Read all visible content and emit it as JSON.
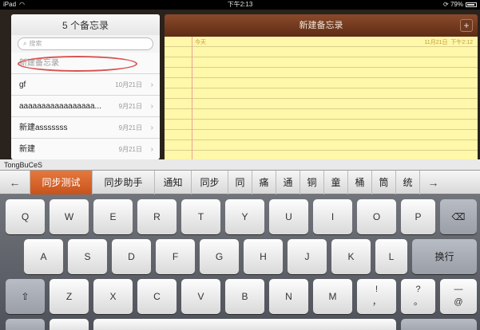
{
  "status_bar": {
    "device": "iPad",
    "time": "下午2:13",
    "battery": "79%"
  },
  "notes_list": {
    "title": "5 个备忘录",
    "search_placeholder": "搜索",
    "items": [
      {
        "title": "新建备忘录",
        "date": ""
      },
      {
        "title": "gf",
        "date": "10月21日"
      },
      {
        "title": "aaaaaaaaaaaaaaaaa...",
        "date": "9月21日"
      },
      {
        "title": "新建asssssss",
        "date": "9月21日"
      },
      {
        "title": "新建",
        "date": "9月21日"
      }
    ]
  },
  "note": {
    "header_title": "新建备忘录",
    "add_label": "+",
    "day_label": "今天",
    "date": "11月21日",
    "time": "下午2:12"
  },
  "keyboard": {
    "pinyin": "TongBuCeS",
    "candidates": [
      "同步测试",
      "同步助手",
      "通知",
      "同步",
      "同",
      "痛",
      "通",
      "铜",
      "童",
      "桶",
      "筒",
      "统"
    ],
    "left_arrow": "←",
    "right_arrow": "→",
    "row1": [
      "Q",
      "W",
      "E",
      "R",
      "T",
      "Y",
      "U",
      "I",
      "O",
      "P"
    ],
    "backspace": "⌫",
    "row2": [
      "A",
      "S",
      "D",
      "F",
      "G",
      "H",
      "J",
      "K",
      "L"
    ],
    "return_label": "换行",
    "shift": "⇧",
    "row3": [
      "Z",
      "X",
      "C",
      "V",
      "B",
      "N",
      "M"
    ],
    "punct1_top": "!",
    "punct1_bot": "，",
    "punct2_top": "?",
    "punct2_bot": "。",
    "punct3_top": "—",
    "punct3_bot": "@"
  }
}
